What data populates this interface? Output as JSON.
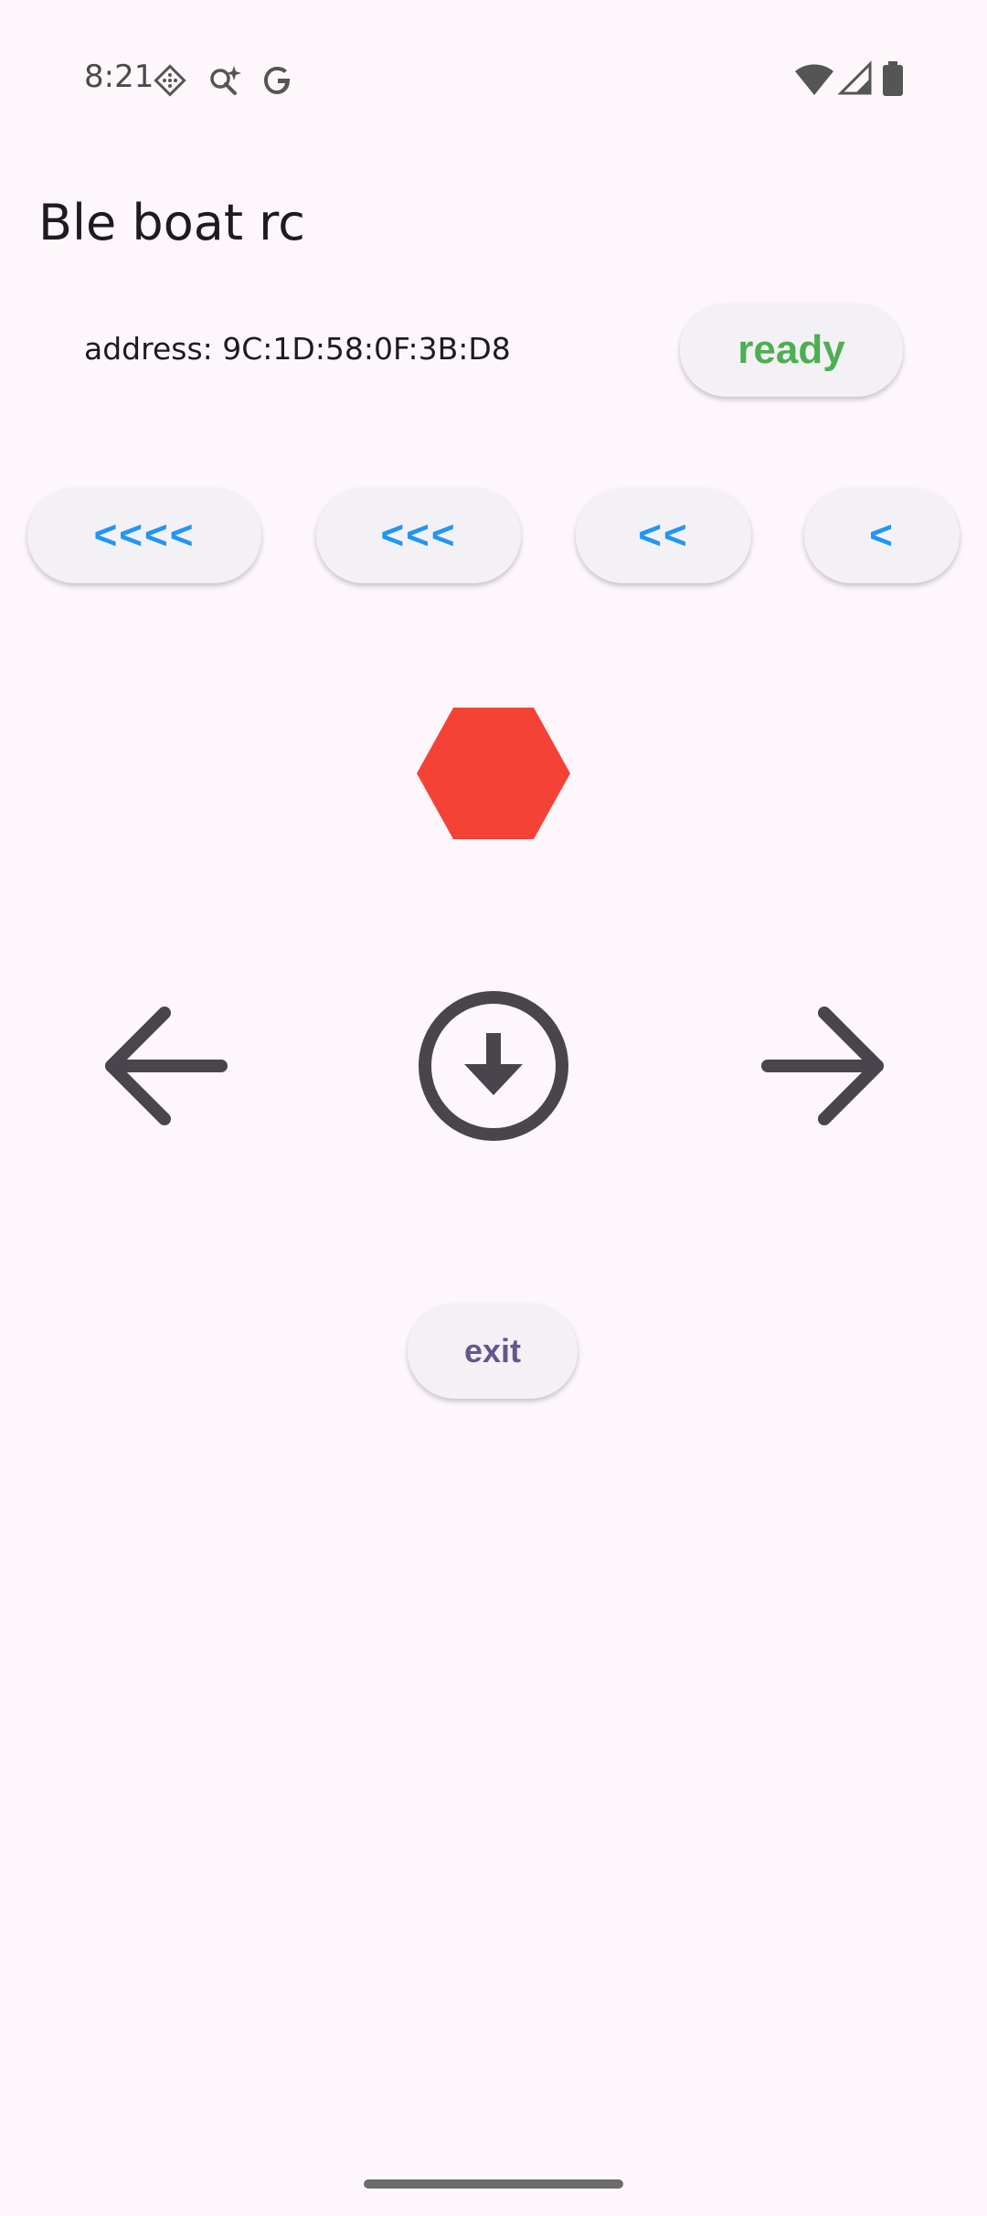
{
  "status_bar": {
    "time": "8:21",
    "icons_left": [
      "grid-diamond-icon",
      "search-sparkle-icon",
      "google-g-icon"
    ],
    "icons_right": [
      "wifi-icon",
      "cell-signal-icon",
      "battery-icon"
    ]
  },
  "app": {
    "title": "Ble boat rc"
  },
  "device": {
    "address_text": "address: 9C:1D:58:0F:3B:D8",
    "status_button": "ready",
    "status_color": "#4caf50"
  },
  "speed_buttons": [
    {
      "label": "<<<<"
    },
    {
      "label": "<<<"
    },
    {
      "label": "<<"
    },
    {
      "label": "<"
    }
  ],
  "controls": {
    "stop_icon": "hexagon-stop-icon",
    "stop_color": "#f44336",
    "left_icon": "arrow-left-icon",
    "reverse_icon": "circle-arrow-down-icon",
    "right_icon": "arrow-right-icon",
    "icon_color": "#48464c"
  },
  "exit_button": "exit",
  "colors": {
    "background": "#fdf7fc",
    "speed_label": "#2196f3",
    "exit_label": "#65558f"
  }
}
